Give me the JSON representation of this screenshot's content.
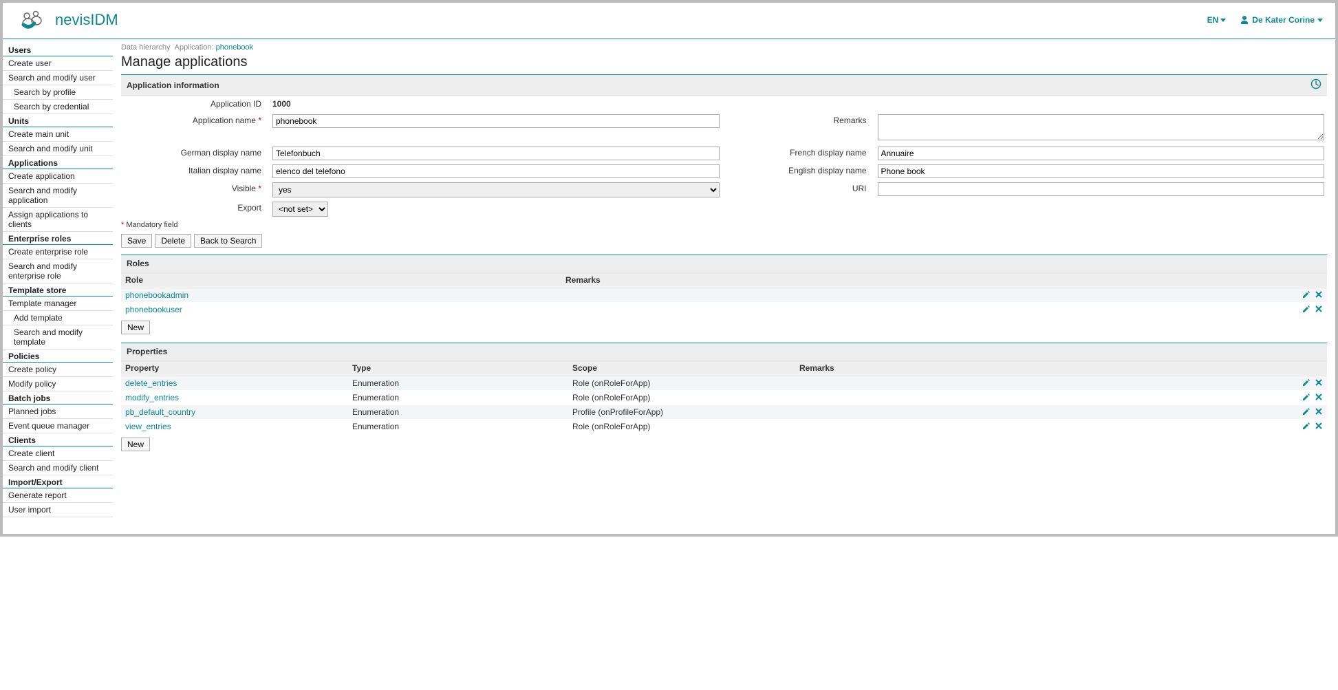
{
  "header": {
    "app_name": "nevisIDM",
    "language": "EN",
    "user_name": "De Kater Corine"
  },
  "sidebar": {
    "sections": [
      {
        "title": "Users",
        "items": [
          {
            "label": "Create user"
          },
          {
            "label": "Search and modify user"
          },
          {
            "label": "Search by profile",
            "sub": true
          },
          {
            "label": "Search by credential",
            "sub": true
          }
        ]
      },
      {
        "title": "Units",
        "items": [
          {
            "label": "Create main unit"
          },
          {
            "label": "Search and modify unit"
          }
        ]
      },
      {
        "title": "Applications",
        "items": [
          {
            "label": "Create application"
          },
          {
            "label": "Search and modify application"
          },
          {
            "label": "Assign applications to clients"
          }
        ]
      },
      {
        "title": "Enterprise roles",
        "items": [
          {
            "label": "Create enterprise role"
          },
          {
            "label": "Search and modify enterprise role"
          }
        ]
      },
      {
        "title": "Template store",
        "items": [
          {
            "label": "Template manager"
          },
          {
            "label": "Add template",
            "sub": true
          },
          {
            "label": "Search and modify template",
            "sub": true
          }
        ]
      },
      {
        "title": "Policies",
        "items": [
          {
            "label": "Create policy"
          },
          {
            "label": "Modify policy"
          }
        ]
      },
      {
        "title": "Batch jobs",
        "items": [
          {
            "label": "Planned jobs"
          },
          {
            "label": "Event queue manager"
          }
        ]
      },
      {
        "title": "Clients",
        "items": [
          {
            "label": "Create client"
          },
          {
            "label": "Search and modify client"
          }
        ]
      },
      {
        "title": "Import/Export",
        "items": [
          {
            "label": "Generate report"
          },
          {
            "label": "User import"
          }
        ]
      }
    ]
  },
  "breadcrumb": {
    "root": "Data hierarchy",
    "crumb_label": "Application:",
    "crumb_value": "phonebook"
  },
  "page_title": "Manage applications",
  "form": {
    "section_title": "Application information",
    "labels": {
      "app_id": "Application ID",
      "app_name": "Application name",
      "remarks": "Remarks",
      "german": "German display name",
      "french": "French display name",
      "italian": "Italian display name",
      "english": "English display name",
      "visible": "Visible",
      "uri": "URI",
      "export": "Export"
    },
    "values": {
      "app_id": "1000",
      "app_name": "phonebook",
      "remarks": "",
      "german": "Telefonbuch",
      "french": "Annuaire",
      "italian": "elenco del telefono",
      "english": "Phone book",
      "visible": "yes",
      "uri": "",
      "export": "<not set>"
    },
    "mandatory_text": "Mandatory field",
    "buttons": {
      "save": "Save",
      "delete": "Delete",
      "back": "Back to Search"
    }
  },
  "roles": {
    "title": "Roles",
    "cols": {
      "role": "Role",
      "remarks": "Remarks"
    },
    "rows": [
      {
        "role": "phonebookadmin",
        "remarks": ""
      },
      {
        "role": "phonebookuser",
        "remarks": ""
      }
    ],
    "new_btn": "New"
  },
  "properties": {
    "title": "Properties",
    "cols": {
      "prop": "Property",
      "type": "Type",
      "scope": "Scope",
      "remarks": "Remarks"
    },
    "rows": [
      {
        "prop": "delete_entries",
        "type": "Enumeration",
        "scope": "Role (onRoleForApp)",
        "remarks": ""
      },
      {
        "prop": "modify_entries",
        "type": "Enumeration",
        "scope": "Role (onRoleForApp)",
        "remarks": ""
      },
      {
        "prop": "pb_default_country",
        "type": "Enumeration",
        "scope": "Profile (onProfileForApp)",
        "remarks": ""
      },
      {
        "prop": "view_entries",
        "type": "Enumeration",
        "scope": "Role (onRoleForApp)",
        "remarks": ""
      }
    ],
    "new_btn": "New"
  }
}
